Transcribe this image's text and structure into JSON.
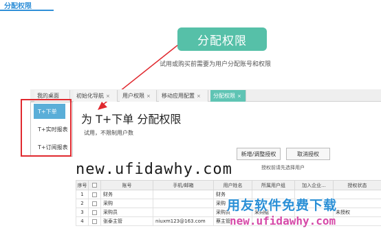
{
  "header": {
    "title": "分配权限"
  },
  "hero": {
    "button_label": "分配权限",
    "subtitle": "试用或购买前需要为用户分配账号和权限"
  },
  "tabs": [
    {
      "label": "我的桌面",
      "closable": false
    },
    {
      "label": "初始化导航",
      "closable": true
    },
    {
      "label": "用户权限",
      "closable": true
    },
    {
      "label": "移动应用配置",
      "closable": true
    },
    {
      "label": "分配权限",
      "closable": true,
      "active": true
    }
  ],
  "close_glyph": "×",
  "menu": {
    "items": [
      {
        "label": "T+下单",
        "active": true
      },
      {
        "label": "T+实时报表"
      },
      {
        "label": "T+订阅报表"
      }
    ]
  },
  "page": {
    "title": "为 T+下单 分配权限",
    "note": "试用，不限制用户数"
  },
  "actions": {
    "add_label": "新增/调整授权",
    "cancel_label": "取消授权",
    "hint": "授权前请先选择用户"
  },
  "watermark": {
    "text": "new.ufidawhy.com"
  },
  "table": {
    "headers": [
      "序号",
      "",
      "账号",
      "手机/邮箱",
      "用户姓名",
      "所属用户组",
      "加入企业...",
      "授权状态"
    ],
    "rows": [
      [
        "1",
        "",
        "财务",
        "",
        "财务",
        "",
        "",
        ""
      ],
      [
        "2",
        "",
        "采购",
        "",
        "采购",
        "",
        "",
        ""
      ],
      [
        "3",
        "",
        "采购员",
        "",
        "采购员",
        "采购组",
        "",
        "未授权"
      ],
      [
        "4",
        "",
        "张泰主管",
        "niuxm123@163.com",
        "蔡主管",
        "",
        "",
        ""
      ]
    ]
  },
  "brand": {
    "cn": "用友软件免费下载",
    "url": "new.ufidawhy.com"
  },
  "colors": {
    "accent_teal": "#56c0a8",
    "menu_active": "#5aaed8",
    "highlight_red": "#e0282e",
    "header_blue": "#2f8fd8"
  }
}
